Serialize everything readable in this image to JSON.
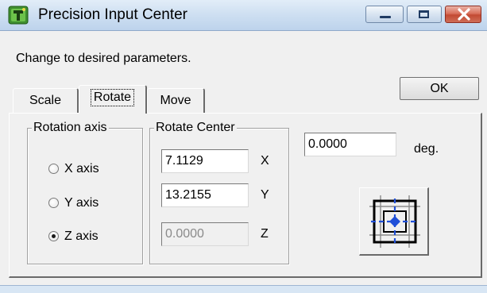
{
  "window": {
    "title": "Precision Input Center",
    "icon": "app-tree-icon"
  },
  "prompt": "Change to desired parameters.",
  "ok_label": "OK",
  "tabs": [
    {
      "label": "Scale",
      "active": false
    },
    {
      "label": "Rotate",
      "active": true
    },
    {
      "label": "Move",
      "active": false
    }
  ],
  "rotation_axis": {
    "title": "Rotation axis",
    "options": [
      {
        "label": "X axis",
        "checked": false
      },
      {
        "label": "Y axis",
        "checked": false
      },
      {
        "label": "Z axis",
        "checked": true
      }
    ]
  },
  "rotate_center": {
    "title": "Rotate Center",
    "fields": [
      {
        "axis": "X",
        "value": "7.1129",
        "enabled": true
      },
      {
        "axis": "Y",
        "value": "13.2155",
        "enabled": true
      },
      {
        "axis": "Z",
        "value": "0.0000",
        "enabled": false
      }
    ]
  },
  "angle": {
    "value": "0.0000",
    "unit": "deg."
  },
  "center_button_icon": "rotate-center-grid-icon",
  "colors": {
    "titlebar": "#cfe0f2",
    "close_button": "#c24a33",
    "accent_blue": "#1f4fd8"
  }
}
